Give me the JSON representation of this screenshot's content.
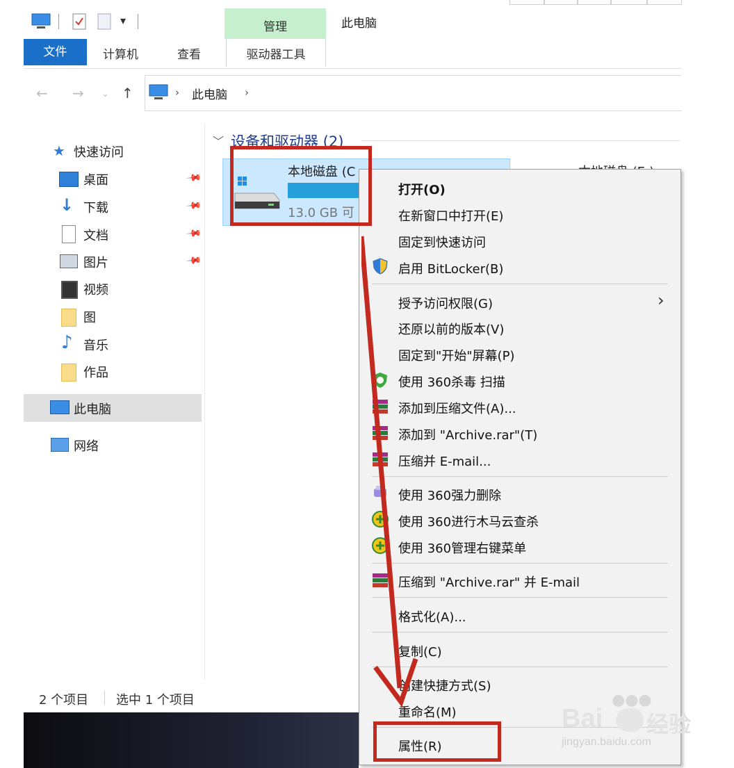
{
  "ribbon": {
    "context_tab_group": "管理",
    "window_title": "此电脑",
    "file_tab": "文件",
    "tabs": [
      "计算机",
      "查看"
    ],
    "context_tab": "驱动器工具"
  },
  "address_bar": {
    "path": "此电脑"
  },
  "nav_pane": {
    "quick_access": "快速访问",
    "items": [
      "桌面",
      "下载",
      "文档",
      "图片",
      "视频",
      "图",
      "音乐",
      "作品"
    ],
    "this_pc": "此电脑",
    "network": "网络"
  },
  "content": {
    "group_title": "设备和驱动器 (2)",
    "drive_name": "本地磁盘 (C",
    "drive_free": "13.0 GB 可",
    "second_drive": "本地磁盘 (E:)"
  },
  "status_bar": {
    "count": "2 个项目",
    "selected": "选中 1 个项目"
  },
  "context_menu": {
    "items": [
      "打开(O)",
      "在新窗口中打开(E)",
      "固定到快速访问",
      "启用 BitLocker(B)",
      "授予访问权限(G)",
      "还原以前的版本(V)",
      "固定到\"开始\"屏幕(P)",
      "使用 360杀毒 扫描",
      "添加到压缩文件(A)...",
      "添加到 \"Archive.rar\"(T)",
      "压缩并 E-mail...",
      "使用 360强力删除",
      "使用 360进行木马云查杀",
      "使用 360管理右键菜单",
      "压缩到 \"Archive.rar\" 并 E-mail",
      "格式化(A)...",
      "复制(C)",
      "创建快捷方式(S)",
      "重命名(M)",
      "属性(R)"
    ]
  },
  "watermark": {
    "brand": "Bai",
    "brand2": "经验",
    "url": "jingyan.baidu.com"
  },
  "colors": {
    "file_tab": "#1a6fc9",
    "manage_band": "#c6efce",
    "selection": "#cce8ff",
    "annotation_red": "#c22a1f"
  }
}
